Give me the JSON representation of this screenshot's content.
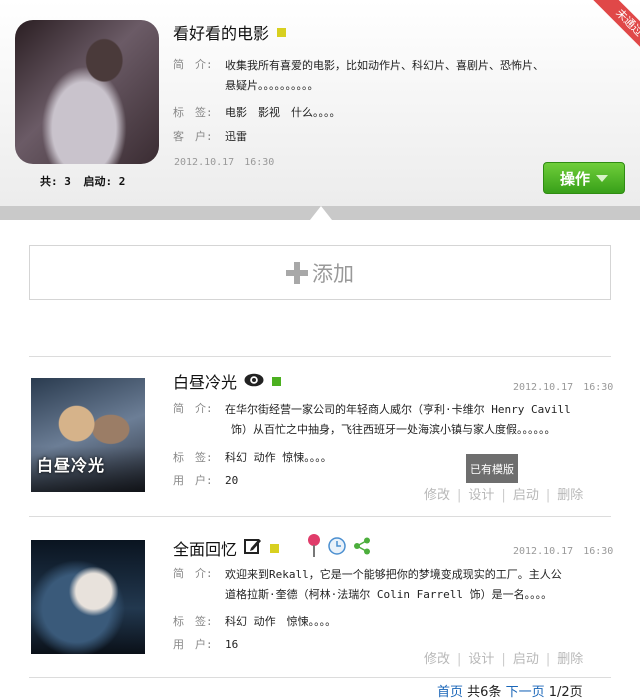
{
  "header": {
    "ribbon": "未通过",
    "title": "看好看的电影",
    "title_badge_color": "#d8d020",
    "stats": {
      "total": "共: 3",
      "started": "启动: 2"
    },
    "intro_label": "简　介:",
    "intro_line1": "收集我所有喜爱的电影，比如动作片、科幻片、喜剧片、恐怖片、",
    "intro_line2": "悬疑片。。。。。。。。。。",
    "tags_label": "标　签:",
    "tags": "电影　影视　什么。。。。",
    "client_label": "客　户:",
    "client": "迅雷",
    "date": "2012.10.17　16:30",
    "operate_label": "操作"
  },
  "add": {
    "label": "添加"
  },
  "items": [
    {
      "title": "白昼冷光",
      "thumb_text": "白昼冷光",
      "date": "2012.10.17　16:30",
      "badge_color": "#4cb020",
      "intro_label": "简　介:",
      "intro_line1": "在华尔街经营一家公司的年轻商人威尔（亨利·卡维尔 Henry Cavill",
      "intro_line2": "饰）从百忙之中抽身，飞往西班牙一处海滨小镇与家人度假。。。。。。",
      "tags_label": "标　签:",
      "tags": "科幻 动作 惊悚。。。。",
      "users_label": "用　户:",
      "users": "20",
      "template_label": "已有模版",
      "actions": [
        "修改",
        "设计",
        "启动",
        "删除"
      ]
    },
    {
      "title": "全面回忆",
      "date": "2012.10.17　16:30",
      "badge_color": "#d8d020",
      "intro_label": "简　介:",
      "intro_line1": "欢迎来到Rekall，它是一个能够把你的梦境变成现实的工厂。主人公",
      "intro_line2": "道格拉斯·奎德（柯林·法瑞尔 Colin Farrell 饰）是一名。。。。",
      "tags_label": "标　签:",
      "tags": "科幻 动作　惊悚。。。。",
      "users_label": "用　户:",
      "users": "16",
      "actions": [
        "修改",
        "设计",
        "启动",
        "删除"
      ]
    }
  ],
  "pager": {
    "first": "首页",
    "total": "共6条",
    "next": "下一页",
    "page": "1/2页"
  }
}
